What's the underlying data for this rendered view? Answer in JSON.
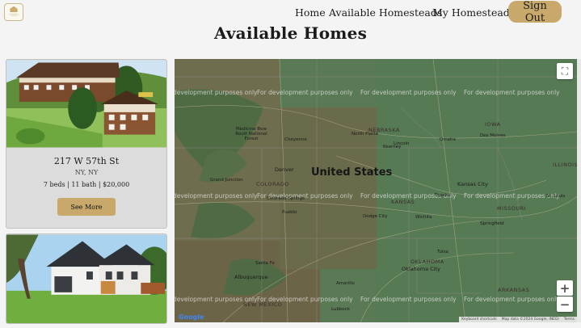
{
  "nav": {
    "home": "Home",
    "available": "Available Homesteads",
    "mine": "My Homesteads",
    "signout": "Sign Out"
  },
  "page_title": "Available Homes",
  "listings": [
    {
      "address": "217 W 57th St",
      "city": "NY, NY",
      "details": "7 beds | 11 bath | $20,000",
      "button": "See More"
    }
  ],
  "map": {
    "country_label": "United States",
    "watermark": "For development purposes only",
    "watermark_partial": "development purposes only",
    "state_labels": [
      "NEBRASKA",
      "KANSAS",
      "COLORADO",
      "IOWA",
      "MISSOURI",
      "ILLINOIS",
      "OKLAHOMA",
      "ARKANSAS",
      "NEW MEXICO"
    ],
    "places": [
      "Denver",
      "Omaha",
      "Kansas City",
      "Oklahoma City",
      "Albuquerque",
      "Colorado Springs",
      "Wichita",
      "Des Moines",
      "Lincoln",
      "Topeka",
      "St. Louis",
      "Tulsa",
      "Springfield",
      "Santa Fe",
      "Pueblo",
      "Medicine Bow Routt National Forest",
      "Dodge City",
      "Amarillo",
      "Lubbock",
      "Cheyenne",
      "North Platte",
      "Kearney",
      "Grand Junction"
    ],
    "attribution": [
      "Keyboard shortcuts",
      "Map data ©2024 Google, INEGI",
      "Terms"
    ],
    "google": "Google",
    "zoom_in": "+",
    "zoom_out": "−",
    "fullscreen": "⛶"
  },
  "colors": {
    "accent": "#c9a96b",
    "card_bg": "#dcdcdc",
    "background": "#f4f4f4"
  }
}
